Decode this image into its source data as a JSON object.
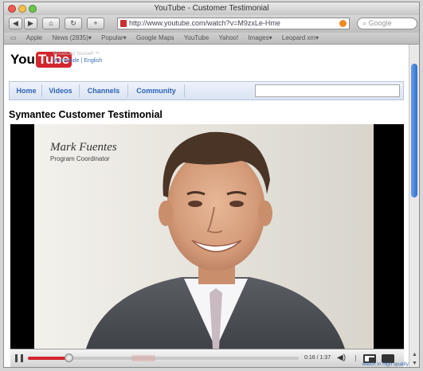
{
  "browser": {
    "window_title": "YouTube - Customer Testimonial",
    "url": "http://www.youtube.com/watch?v=M9zxLe-Hme",
    "search_placeholder": "Google",
    "bookmarks": [
      "Apple",
      "News (2835)▾",
      "Popular▾",
      "Google Maps",
      "YouTube",
      "Yahoo!",
      "Images▾",
      "Leopard xm▾"
    ]
  },
  "site": {
    "logo_you": "You",
    "logo_tube": "Tube",
    "tagline": "Broadcast Yourself ™",
    "region": "Worldwide | English",
    "nav": [
      "Home",
      "Videos",
      "Channels",
      "Community"
    ]
  },
  "video": {
    "title": "Symantec Customer Testimonial",
    "speaker_name": "Mark Fuentes",
    "speaker_role": "Program Coordinator",
    "time": "0:16 / 1:37",
    "progress": 0.15,
    "hq_link": "watch in high quality"
  },
  "colors": {
    "accent_red": "#d3262e",
    "link_blue": "#3b6fb6",
    "scroll_blue": "#2f6fd0"
  }
}
